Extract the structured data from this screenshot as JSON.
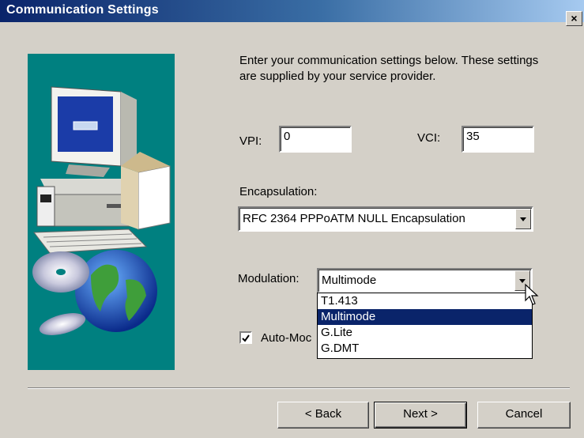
{
  "window": {
    "title": "Communication Settings",
    "close_label": "×"
  },
  "intro": {
    "text": "Enter your communication settings below.  These settings are supplied by your service provider."
  },
  "vpi": {
    "label": "VPI:",
    "value": "0"
  },
  "vci": {
    "label": "VCI:",
    "value": "35"
  },
  "encapsulation": {
    "label": "Encapsulation:",
    "selected": "RFC 2364 PPPoATM NULL Encapsulation"
  },
  "modulation": {
    "label": "Modulation:",
    "selected": "Multimode",
    "options": [
      "T1.413",
      "Multimode",
      "G.Lite",
      "G.DMT"
    ],
    "highlighted_index": 1
  },
  "auto_mode": {
    "label_visible": "Auto-Moc",
    "checked": true
  },
  "buttons": {
    "back": "< Back",
    "next": "Next >",
    "cancel": "Cancel"
  },
  "icons": [
    "close-icon",
    "computer-icon",
    "cd-icon",
    "globe-icon",
    "dropdown-arrow-icon",
    "checkmark-icon",
    "mouse-cursor-icon"
  ]
}
